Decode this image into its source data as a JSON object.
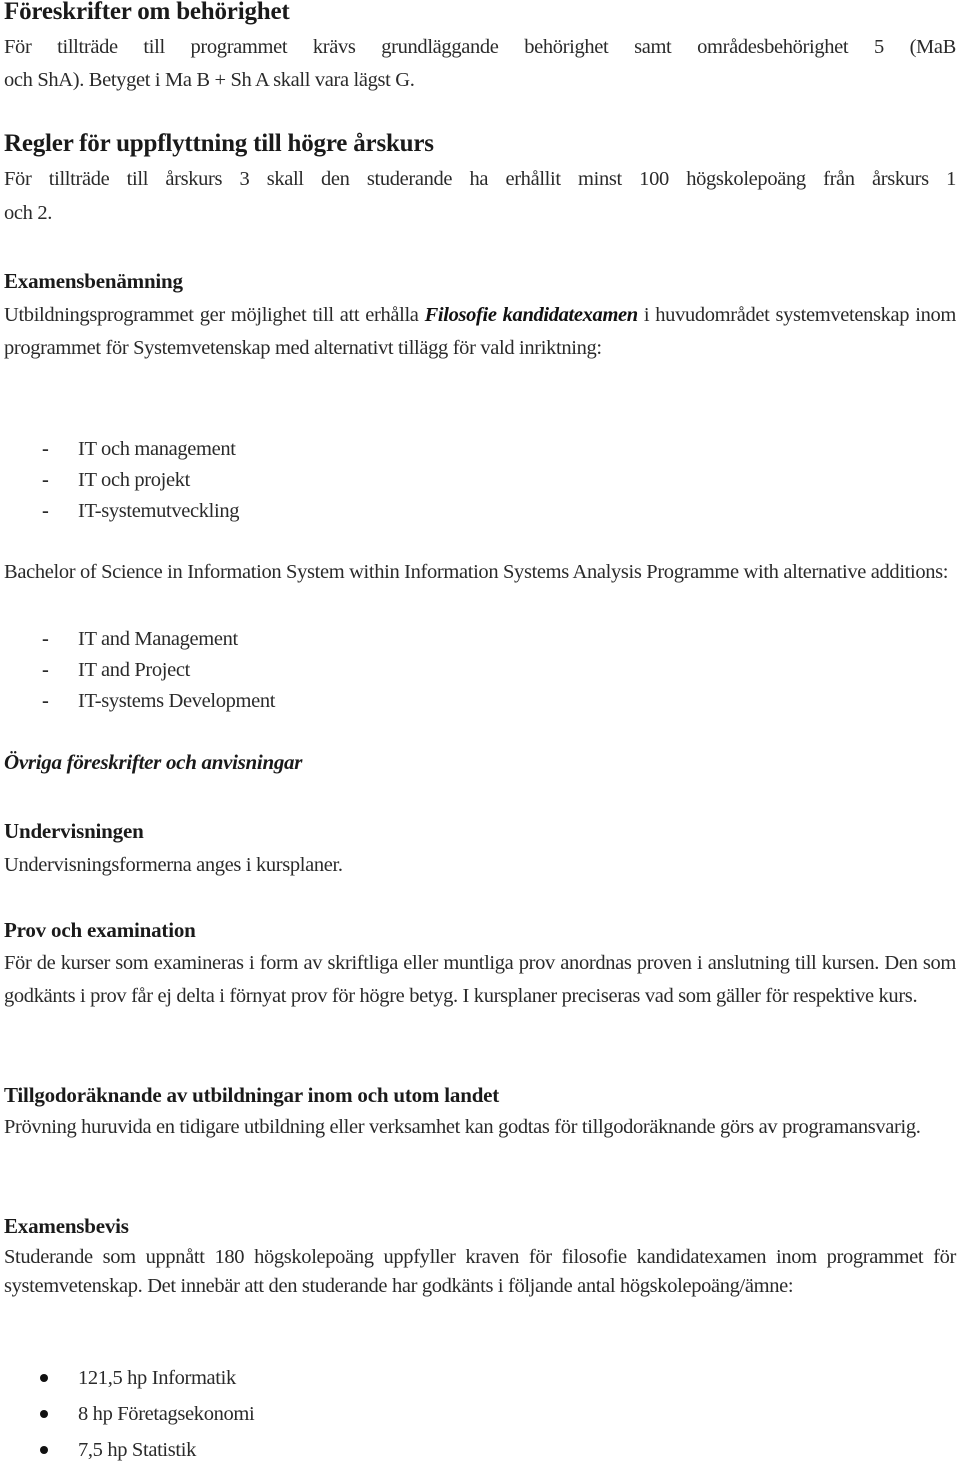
{
  "document": {
    "sections": {
      "eligibility": {
        "heading": "Föreskrifter om behörighet",
        "line1": "För tillträde till programmet krävs grundläggande behörighet samt områdesbehörighet 5 (MaB",
        "line2": "och ShA). Betyget i Ma B + Sh A skall vara lägst G."
      },
      "promotion": {
        "heading": "Regler för uppflyttning till högre årskurs",
        "line1": "För tillträde till årskurs 3 skall den studerande ha erhållit minst 100 högskolepoäng från årskurs 1",
        "line2": "och 2."
      },
      "degree_title": {
        "heading": "Examensbenämning",
        "text_before": "Utbildningsprogrammet ger möjlighet till att erhålla ",
        "emphasis": "Filosofie kandidatexamen",
        "text_after": " i huvudområdet systemvetenskap inom programmet för Systemvetenskap med alternativt tillägg för vald inriktning:",
        "tracks_sv": [
          "IT och management",
          "IT och projekt",
          "IT-systemutveckling"
        ],
        "english_intro": "Bachelor of Science in Information System within Information Systems Analysis Programme with alternative additions:",
        "tracks_en": [
          "IT and Management",
          "IT and Project",
          "IT-systems Development"
        ],
        "list_marker": "-"
      },
      "other_rules": {
        "heading": "Övriga föreskrifter och anvisningar"
      },
      "teaching": {
        "heading": "Undervisningen",
        "text": "Undervisningsformerna anges i kursplaner."
      },
      "examination": {
        "heading": "Prov och examination",
        "text": "För de kurser som examineras i form av skriftliga eller muntliga prov anordnas proven i anslutning till kursen. Den som godkänts i prov får ej delta i förnyat prov för högre betyg. I kursplaner preciseras vad som gäller för respektive kurs."
      },
      "credit_transfer": {
        "heading": "Tillgodoräknande av utbildningar inom och utom landet",
        "text": "Prövning huruvida en tidigare utbildning eller verksamhet kan godtas för tillgodoräknande görs av programansvarig."
      },
      "diploma": {
        "heading": "Examensbevis",
        "text": "Studerande som uppnått 180 högskolepoäng uppfyller kraven för filosofie kandidatexamen inom programmet för systemvetenskap. Det innebär att den studerande har godkänts i följande antal högskolepoäng/ämne:",
        "credits": [
          {
            "label": "121,5 hp Informatik",
            "hp": "121,5",
            "subject": "Informatik"
          },
          {
            "label": "8 hp Företagsekonomi",
            "hp": "8",
            "subject": "Företagsekonomi"
          },
          {
            "label": "7,5 hp Statistik",
            "hp": "7,5",
            "subject": "Statistik"
          }
        ]
      }
    }
  }
}
